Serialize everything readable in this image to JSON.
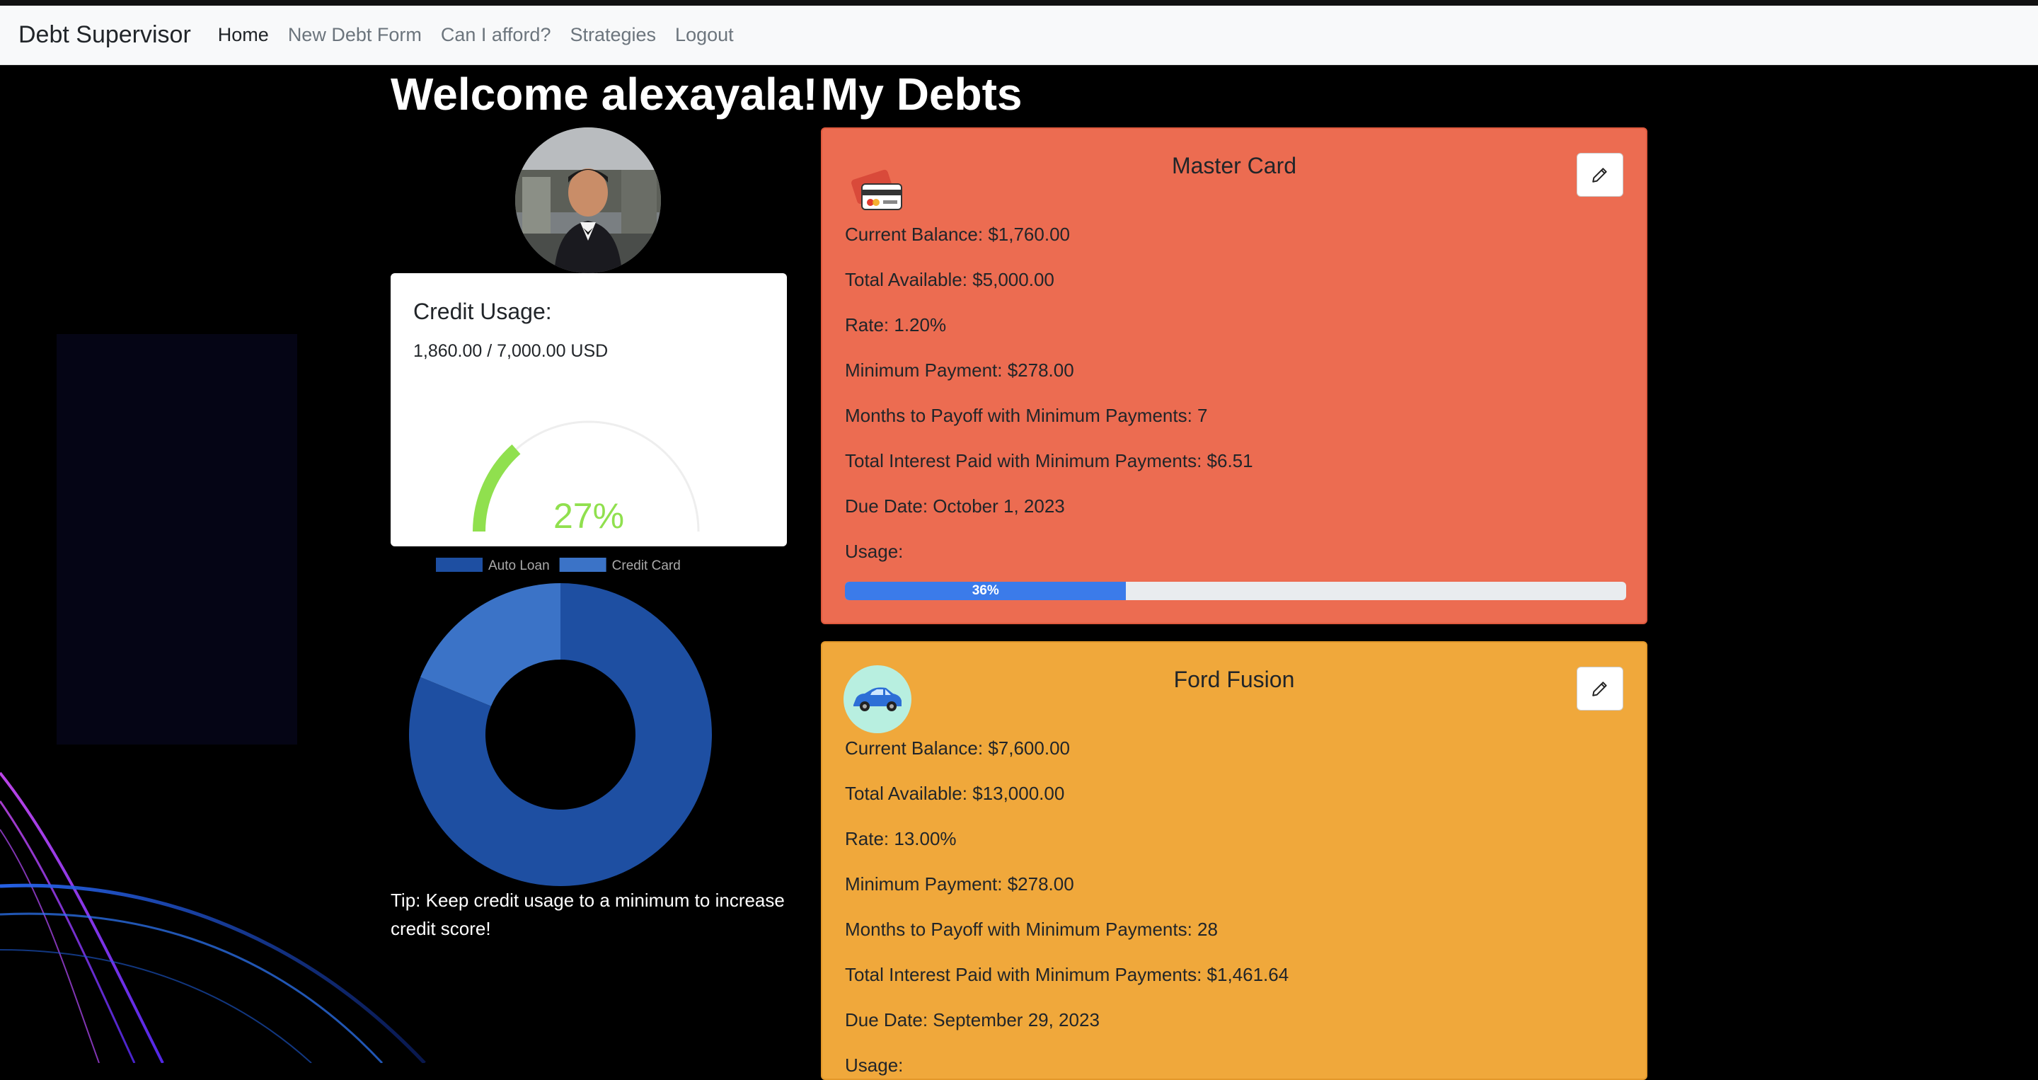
{
  "nav": {
    "brand": "Debt Supervisor",
    "links": [
      {
        "label": "Home",
        "active": true
      },
      {
        "label": "New Debt Form",
        "active": false
      },
      {
        "label": "Can I afford?",
        "active": false
      },
      {
        "label": "Strategies",
        "active": false
      },
      {
        "label": "Logout",
        "active": false
      }
    ]
  },
  "welcome": "Welcome alexayala!",
  "my_debts_title": "My Debts",
  "credit_usage": {
    "title": "Credit Usage:",
    "amount": "1,860.00 / 7,000.00 USD",
    "percent_label": "27%",
    "percent_value": 27,
    "gauge_color": "#90e04e"
  },
  "chart_data": {
    "type": "pie",
    "variant": "doughnut",
    "legend_position": "top",
    "series": [
      {
        "name": "Auto Loan",
        "value": 7600,
        "color": "#1e4fa2"
      },
      {
        "name": "Credit Card",
        "value": 1760,
        "color": "#3b73c7"
      }
    ]
  },
  "tip": "Tip: Keep credit usage to a minimum to increase credit score!",
  "debts": [
    {
      "title": "Master Card",
      "icon": "credit-card-icon",
      "current_balance": "Current Balance: $1,760.00",
      "total_available": "Total Available: $5,000.00",
      "rate": "Rate: 1.20%",
      "minimum_payment": "Minimum Payment: $278.00",
      "months_to_payoff": "Months to Payoff with Minimum Payments: 7",
      "total_interest": "Total Interest Paid with Minimum Payments: $6.51",
      "due_date": "Due Date: October 1, 2023",
      "usage_label": "Usage:",
      "usage_percent_label": "36%",
      "usage_percent": 36,
      "color": "#ec6c51"
    },
    {
      "title": "Ford Fusion",
      "icon": "car-icon",
      "current_balance": "Current Balance: $7,600.00",
      "total_available": "Total Available: $13,000.00",
      "rate": "Rate: 13.00%",
      "minimum_payment": "Minimum Payment: $278.00",
      "months_to_payoff": "Months to Payoff with Minimum Payments: 28",
      "total_interest": "Total Interest Paid with Minimum Payments: $1,461.64",
      "due_date": "Due Date: September 29, 2023",
      "usage_label": "Usage:",
      "color": "#f0a83b"
    }
  ]
}
